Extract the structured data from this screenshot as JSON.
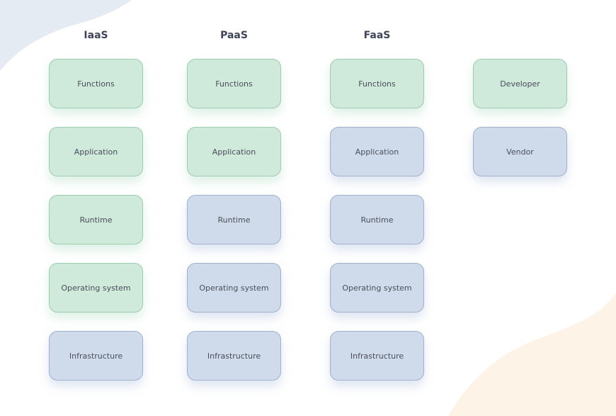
{
  "colors": {
    "developer_fill": "#cfe9db",
    "developer_border": "#9fcbb0",
    "vendor_fill": "#cfdbea",
    "vendor_border": "#9fb1cc",
    "blob_top_left": "#e5ebf3",
    "blob_bottom_right": "#fdf3e6"
  },
  "columns": [
    {
      "title": "IaaS",
      "layers": [
        {
          "label": "Functions",
          "owner": "developer"
        },
        {
          "label": "Application",
          "owner": "developer"
        },
        {
          "label": "Runtime",
          "owner": "developer"
        },
        {
          "label": "Operating system",
          "owner": "developer"
        },
        {
          "label": "Infrastructure",
          "owner": "vendor"
        }
      ]
    },
    {
      "title": "PaaS",
      "layers": [
        {
          "label": "Functions",
          "owner": "developer"
        },
        {
          "label": "Application",
          "owner": "developer"
        },
        {
          "label": "Runtime",
          "owner": "vendor"
        },
        {
          "label": "Operating system",
          "owner": "vendor"
        },
        {
          "label": "Infrastructure",
          "owner": "vendor"
        }
      ]
    },
    {
      "title": "FaaS",
      "layers": [
        {
          "label": "Functions",
          "owner": "developer"
        },
        {
          "label": "Application",
          "owner": "vendor"
        },
        {
          "label": "Runtime",
          "owner": "vendor"
        },
        {
          "label": "Operating system",
          "owner": "vendor"
        },
        {
          "label": "Infrastructure",
          "owner": "vendor"
        }
      ]
    }
  ],
  "legend": [
    {
      "label": "Developer",
      "owner": "developer"
    },
    {
      "label": "Vendor",
      "owner": "vendor"
    }
  ]
}
